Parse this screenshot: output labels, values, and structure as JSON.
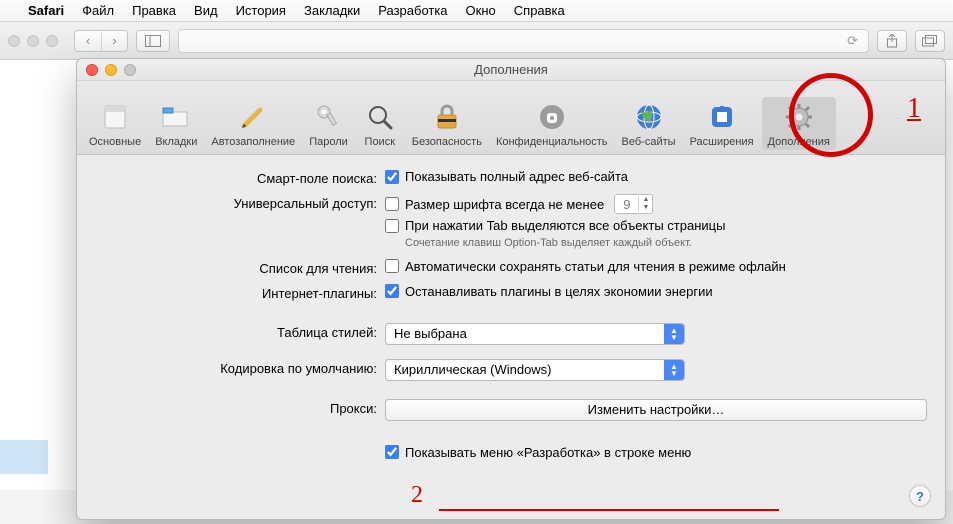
{
  "menubar": {
    "app": "Safari",
    "items": [
      "Файл",
      "Правка",
      "Вид",
      "История",
      "Закладки",
      "Разработка",
      "Окно",
      "Справка"
    ]
  },
  "prefs": {
    "title": "Дополнения",
    "tabs": [
      {
        "label": "Основные"
      },
      {
        "label": "Вкладки"
      },
      {
        "label": "Автозаполнение"
      },
      {
        "label": "Пароли"
      },
      {
        "label": "Поиск"
      },
      {
        "label": "Безопасность"
      },
      {
        "label": "Конфиденциальность"
      },
      {
        "label": "Веб-сайты"
      },
      {
        "label": "Расширения"
      },
      {
        "label": "Дополнения"
      }
    ],
    "smart_label": "Смарт-поле поиска:",
    "smart_check": "Показывать полный адрес веб-сайта",
    "access_label": "Универсальный доступ:",
    "access_check1": "Размер шрифта всегда не менее",
    "access_font_size": "9",
    "access_check2": "При нажатии Tab выделяются все объекты страницы",
    "access_note": "Сочетание клавиш Option-Tab выделяет каждый объект.",
    "reading_label": "Список для чтения:",
    "reading_check": "Автоматически сохранять статьи для чтения в режиме офлайн",
    "plugins_label": "Интернет-плагины:",
    "plugins_check": "Останавливать плагины в целях экономии энергии",
    "stylesheet_label": "Таблица стилей:",
    "stylesheet_value": "Не выбрана",
    "encoding_label": "Кодировка по умолчанию:",
    "encoding_value": "Кириллическая (Windows)",
    "proxy_label": "Прокси:",
    "proxy_button": "Изменить настройки…",
    "develop_check": "Показывать меню «Разработка» в строке меню",
    "help": "?"
  },
  "annotations": {
    "one": "1",
    "two": "2"
  }
}
